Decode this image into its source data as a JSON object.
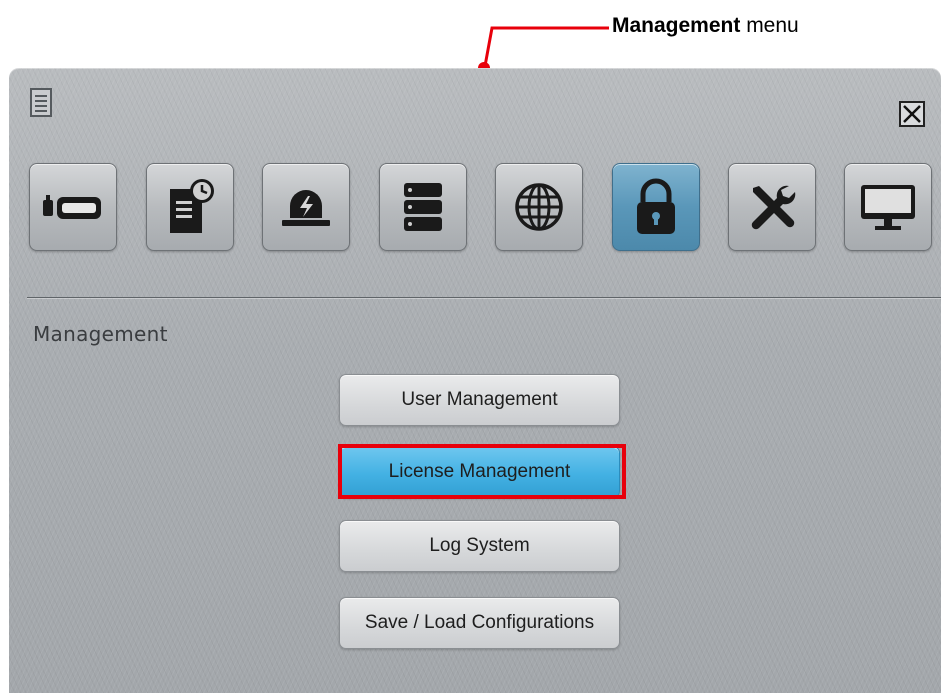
{
  "callout": {
    "bold": "Management",
    "rest": " menu",
    "color": "#e8000b"
  },
  "window": {
    "menu_icon": "document-list-icon",
    "close_icon": "close-x-icon"
  },
  "toolbar": {
    "tiles": [
      {
        "icon": "camera-icon",
        "active": false
      },
      {
        "icon": "schedule-report-icon",
        "active": false
      },
      {
        "icon": "alarm-siren-icon",
        "active": false
      },
      {
        "icon": "storage-server-icon",
        "active": false
      },
      {
        "icon": "network-globe-icon",
        "active": false
      },
      {
        "icon": "lock-icon",
        "active": true
      },
      {
        "icon": "tools-icon",
        "active": false
      },
      {
        "icon": "monitor-icon",
        "active": false
      }
    ]
  },
  "section": {
    "title": "Management"
  },
  "buttons": [
    {
      "label": "User Management",
      "active": false
    },
    {
      "label": "License Management",
      "active": true
    },
    {
      "label": "Log System",
      "active": false
    },
    {
      "label": "Save / Load Configurations",
      "active": false
    }
  ],
  "colors": {
    "accent_blue": "#43b1e3",
    "active_tile": "#5a97b9",
    "highlight_red": "#e8000b"
  }
}
